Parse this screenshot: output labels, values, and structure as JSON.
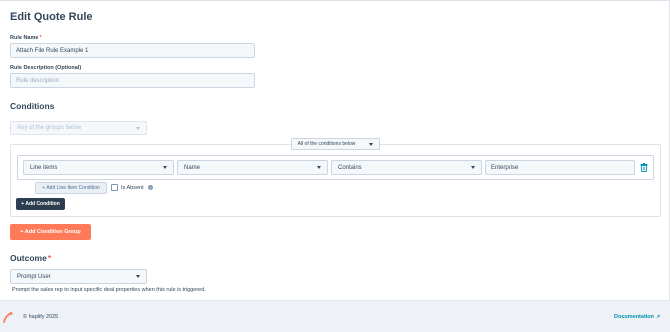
{
  "page": {
    "title": "Edit Quote Rule"
  },
  "form": {
    "rule_name_label": "Rule Name",
    "required_mark": "*",
    "rule_name_value": "Attach File Rule Example 1",
    "rule_description_label": "Rule Description (Optional)",
    "rule_description_placeholder": "Rule description"
  },
  "conditions": {
    "title": "Conditions",
    "groups_select": "Any of the groups below",
    "group_mode_select": "All of the conditions below",
    "condition": {
      "object": "Line items",
      "property": "Name",
      "operator": "Contains",
      "value": "Enterprise"
    },
    "add_line_item_condition": "+ Add Line Item Condition",
    "is_absent_label": "Is Absent",
    "info_icon_glyph": "i",
    "add_condition": "+ Add Condition",
    "add_condition_group": "+ Add Condition Group"
  },
  "outcome": {
    "title": "Outcome",
    "required_mark": "*",
    "select_value": "Prompt User",
    "description": "Prompt the sales rep to input specific deal properties when this rule is triggered."
  },
  "footer": {
    "copyright": "© haplify 2025",
    "documentation_link": "Documentation",
    "external_icon": "↗"
  },
  "colors": {
    "accent": "#ff7a59",
    "dark_button": "#2d3e50",
    "link": "#0091ae",
    "text": "#33475b",
    "footer_bg": "#eef2f7"
  },
  "icons": [
    "trash-icon",
    "chevron-down-icon",
    "info-icon",
    "external-link-icon",
    "logo-icon"
  ]
}
